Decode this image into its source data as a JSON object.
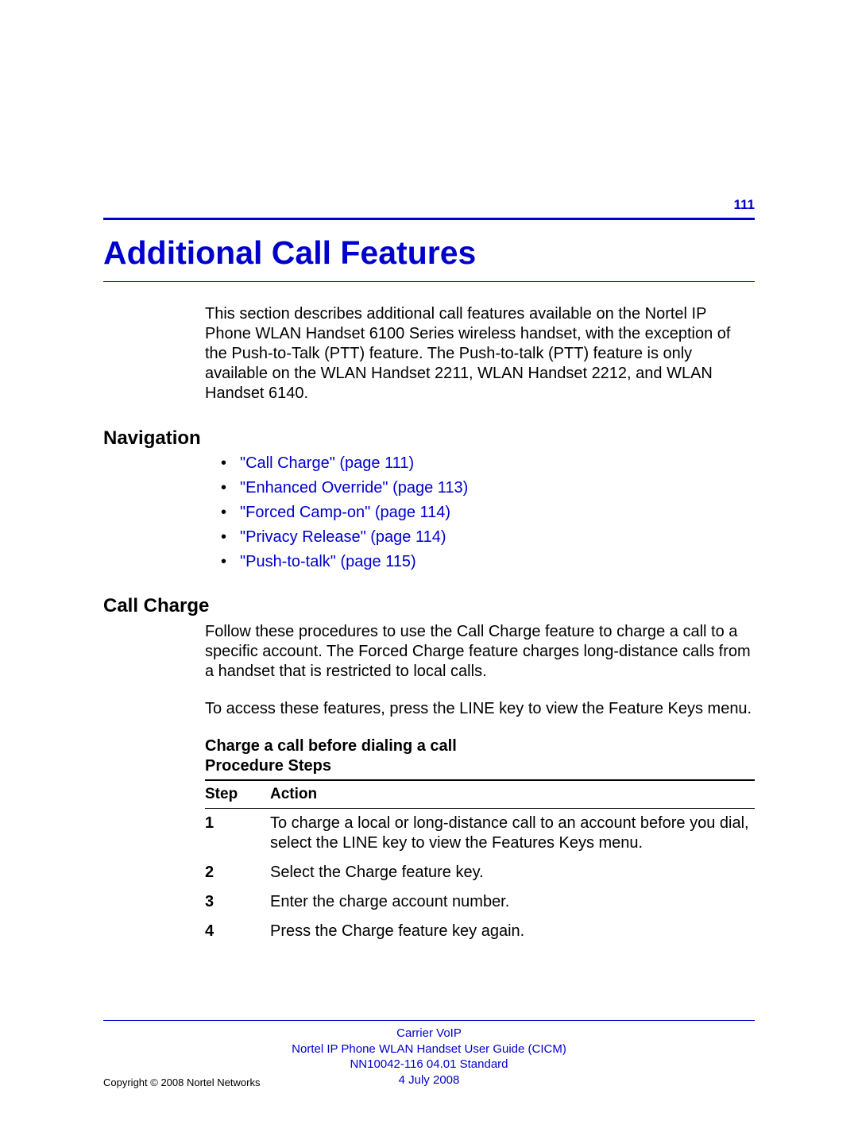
{
  "page_number": "111",
  "chapter_title": "Additional Call Features",
  "intro_paragraph": "This section describes additional call features available on the Nortel IP Phone WLAN Handset 6100 Series wireless handset, with the exception of the Push-to-Talk (PTT) feature. The Push-to-talk (PTT) feature is only available on the WLAN Handset 2211, WLAN Handset 2212, and WLAN Handset 6140.",
  "navigation": {
    "heading": "Navigation",
    "items": [
      "\"Call Charge\" (page 111)",
      "\"Enhanced Override\" (page 113)",
      "\"Forced Camp-on\" (page 114)",
      "\"Privacy Release\" (page 114)",
      "\"Push-to-talk\" (page 115)"
    ]
  },
  "call_charge": {
    "heading": "Call Charge",
    "para1": "Follow these procedures to use the Call Charge feature to charge a call to a specific account. The Forced Charge feature charges long-distance calls from a handset that is restricted to local calls.",
    "para2": "To access these features, press the LINE key to view the Feature Keys menu.",
    "subhead_line1": "Charge a call before dialing a call",
    "subhead_line2": "Procedure Steps",
    "table": {
      "col_step": "Step",
      "col_action": "Action",
      "rows": [
        {
          "step": "1",
          "action": "To charge a local or long-distance call to an account before you dial, select the LINE key to view the Features Keys menu."
        },
        {
          "step": "2",
          "action": "Select the Charge feature key."
        },
        {
          "step": "3",
          "action": "Enter the charge account number."
        },
        {
          "step": "4",
          "action": "Press the Charge feature key again."
        }
      ]
    }
  },
  "footer": {
    "line1": "Carrier VoIP",
    "line2": "Nortel IP Phone WLAN Handset User Guide (CICM)",
    "line3": "NN10042-116   04.01   Standard",
    "line4": "4 July 2008",
    "copyright": "Copyright © 2008 Nortel Networks"
  }
}
